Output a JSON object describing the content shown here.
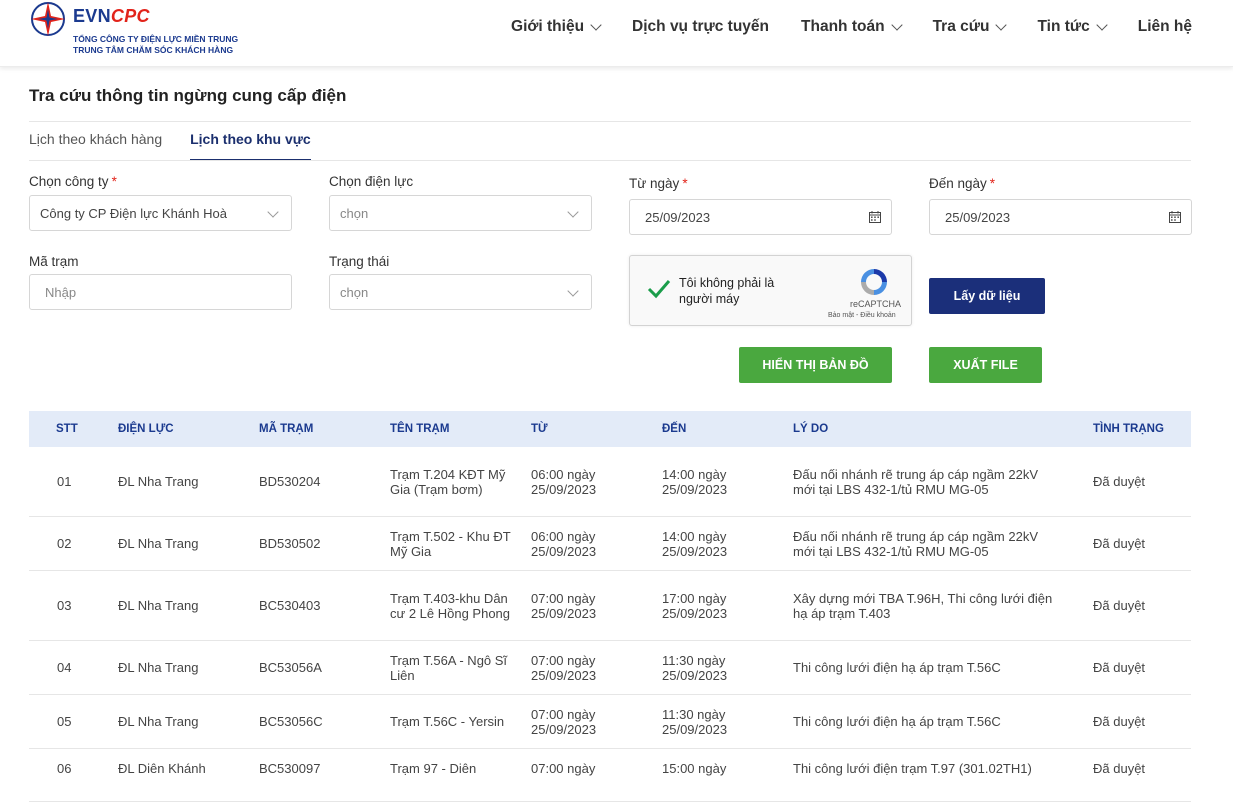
{
  "brand": {
    "name_evn": "EVN",
    "name_cpc": "CPC",
    "sub1": "TỔNG CÔNG TY ĐIỆN LỰC MIỀN TRUNG",
    "sub2": "TRUNG TÂM CHĂM SÓC KHÁCH HÀNG",
    "colors": {
      "primary": "#1b3a8f",
      "accent": "#e2231a",
      "green": "#4aa83f",
      "navy": "#1b2f7a"
    }
  },
  "nav": [
    {
      "label": "Giới thiệu",
      "has_dropdown": true
    },
    {
      "label": "Dịch vụ trực tuyến",
      "has_dropdown": false
    },
    {
      "label": "Thanh toán",
      "has_dropdown": true
    },
    {
      "label": "Tra cứu",
      "has_dropdown": true
    },
    {
      "label": "Tin tức",
      "has_dropdown": true
    },
    {
      "label": "Liên hệ",
      "has_dropdown": false
    }
  ],
  "page": {
    "title": "Tra cứu thông tin ngừng cung cấp điện"
  },
  "tabs": [
    {
      "label": "Lịch theo khách hàng",
      "active": false
    },
    {
      "label": "Lịch theo khu vực",
      "active": true
    }
  ],
  "form": {
    "company": {
      "label": "Chọn công ty",
      "value": "Công ty CP Điện lực Khánh Hoà"
    },
    "branch": {
      "label": "Chọn điện lực",
      "value": "chọn"
    },
    "from_date": {
      "label": "Từ ngày",
      "value": "25/09/2023"
    },
    "to_date": {
      "label": "Đến ngày",
      "value": "25/09/2023"
    },
    "station_code": {
      "label": "Mã trạm",
      "placeholder": "Nhập"
    },
    "status": {
      "label": "Trạng thái",
      "value": "chọn"
    },
    "required_mark": "*"
  },
  "captcha": {
    "text": "Tôi không phải là người máy",
    "brand": "reCAPTCHA",
    "links": "Bảo mật - Điều khoản"
  },
  "buttons": {
    "fetch": "Lấy dữ liệu",
    "map": "HIỂN THỊ BẢN ĐỒ",
    "export": "XUẤT FILE"
  },
  "table": {
    "headers": [
      "STT",
      "ĐIỆN LỰC",
      "MÃ TRẠM",
      "TÊN TRẠM",
      "TỪ",
      "ĐẾN",
      "LÝ DO",
      "TÌNH TRẠNG"
    ],
    "rows": [
      [
        "01",
        "ĐL Nha Trang",
        "BD530204",
        "Trạm T.204 KĐT Mỹ Gia (Trạm bơm)",
        "06:00 ngày 25/09/2023",
        "14:00 ngày 25/09/2023",
        "Đấu nối nhánh rẽ trung áp cáp ngầm 22kV mới tại LBS 432-1/tủ RMU MG-05",
        "Đã duyệt"
      ],
      [
        "02",
        "ĐL Nha Trang",
        "BD530502",
        "Trạm T.502 - Khu ĐT Mỹ Gia",
        "06:00 ngày 25/09/2023",
        "14:00 ngày 25/09/2023",
        "Đấu nối nhánh rẽ trung áp cáp ngầm 22kV mới tại LBS 432-1/tủ RMU MG-05",
        "Đã duyệt"
      ],
      [
        "03",
        "ĐL Nha Trang",
        "BC530403",
        "Trạm T.403-khu Dân cư 2 Lê Hồng Phong",
        "07:00 ngày 25/09/2023",
        "17:00 ngày 25/09/2023",
        "Xây dựng mới TBA T.96H, Thi công lưới điện hạ áp trạm T.403",
        "Đã duyệt"
      ],
      [
        "04",
        "ĐL Nha Trang",
        "BC53056A",
        "Trạm T.56A - Ngô Sĩ Liên",
        "07:00 ngày 25/09/2023",
        "11:30 ngày 25/09/2023",
        "Thi công lưới điện hạ áp trạm T.56C",
        "Đã duyệt"
      ],
      [
        "05",
        "ĐL Nha Trang",
        "BC53056C",
        "Trạm T.56C - Yersin",
        "07:00 ngày 25/09/2023",
        "11:30 ngày 25/09/2023",
        "Thi công lưới điện hạ áp trạm T.56C",
        "Đã duyệt"
      ],
      [
        "06",
        "ĐL Diên Khánh",
        "BC530097",
        "Trạm 97 - Diên",
        "07:00 ngày",
        "15:00 ngày",
        "Thi công lưới điện trạm T.97 (301.02TH1)",
        "Đã duyệt"
      ]
    ]
  }
}
